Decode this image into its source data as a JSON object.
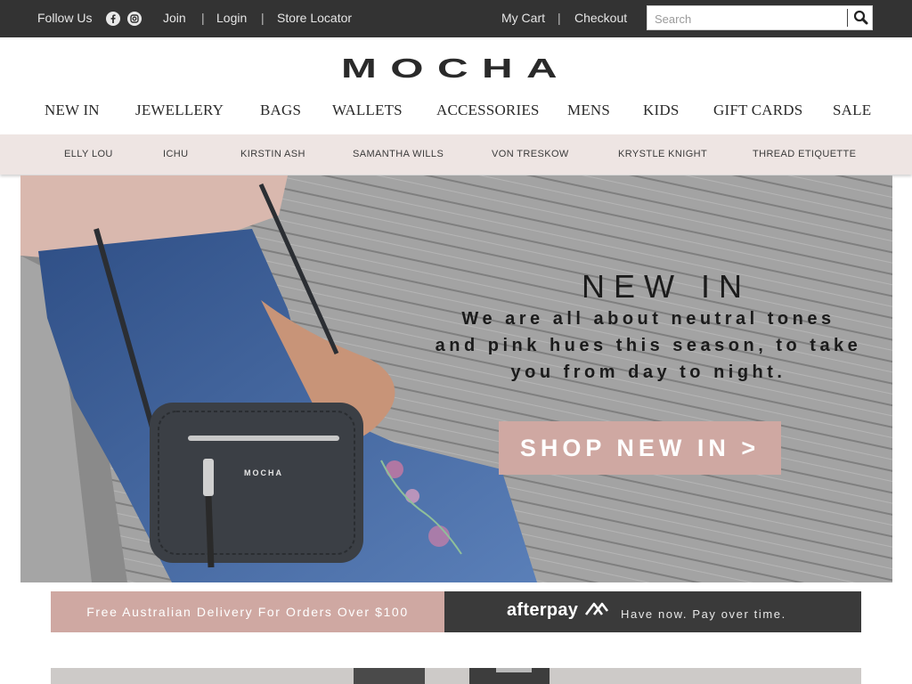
{
  "topbar": {
    "follow_us": "Follow Us",
    "social_icons": [
      "facebook-icon",
      "instagram-icon"
    ],
    "join": "Join",
    "login": "Login",
    "store_locator": "Store Locator",
    "my_cart": "My Cart",
    "checkout": "Checkout",
    "separator": "|",
    "search_placeholder": "Search",
    "search_icon": "search-icon"
  },
  "logo": {
    "text": "MOCHA"
  },
  "main_nav": [
    "NEW IN",
    "JEWELLERY",
    "BAGS",
    "WALLETS",
    "ACCESSORIES",
    "MENS",
    "KIDS",
    "GIFT CARDS",
    "SALE"
  ],
  "brands": [
    "ELLY LOU",
    "ICHU",
    "KIRSTIN ASH",
    "SAMANTHA WILLS",
    "VON TRESKOW",
    "KRYSTLE KNIGHT",
    "THREAD ETIQUETTE"
  ],
  "hero": {
    "title": "NEW IN",
    "subtitle_lines": [
      "We are all about neutral tones",
      "and pink hues this season, to take",
      "you from day to night."
    ],
    "button": "SHOP NEW IN >",
    "bag_logo": "MOCHA"
  },
  "promo": {
    "delivery": "Free Australian Delivery For Orders Over $100",
    "afterpay_logo": "afterpay",
    "afterpay_tagline": "Have now. Pay over time."
  },
  "colors": {
    "topbar_bg": "#333333",
    "brandbar_bg": "#eee5e3",
    "accent_pink": "#cfa8a2",
    "afterpay_bg": "#3a3a3a"
  }
}
